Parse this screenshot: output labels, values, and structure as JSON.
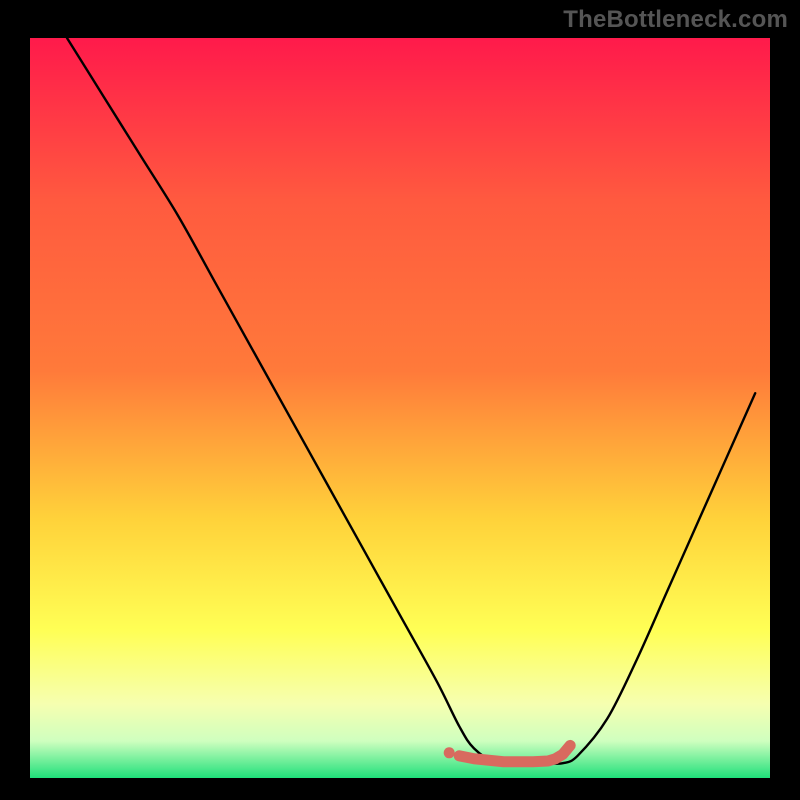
{
  "watermark": "TheBottleneck.com",
  "colors": {
    "bg": "#000000",
    "grad_top": "#ff1a4b",
    "grad_mid1": "#ff7a3a",
    "grad_mid2": "#ffd23a",
    "grad_mid3": "#ffff55",
    "grad_low1": "#f6ffb0",
    "grad_low2": "#cfffbf",
    "grad_bot": "#1fe07a",
    "curve": "#000000",
    "marker": "#d86a5f"
  },
  "chart_data": {
    "type": "line",
    "title": "",
    "xlabel": "",
    "ylabel": "",
    "xlim": [
      0,
      100
    ],
    "ylim": [
      0,
      100
    ],
    "series": [
      {
        "name": "bottleneck-curve",
        "x": [
          5,
          10,
          15,
          20,
          25,
          30,
          35,
          40,
          45,
          50,
          55,
          58,
          60,
          63,
          66,
          70,
          72,
          74,
          78,
          82,
          86,
          90,
          94,
          98
        ],
        "y": [
          100,
          92,
          84,
          76,
          67,
          58,
          49,
          40,
          31,
          22,
          13,
          7,
          4,
          2,
          2,
          2,
          2,
          3,
          8,
          16,
          25,
          34,
          43,
          52
        ]
      }
    ],
    "markers": {
      "name": "optimal-range",
      "x": [
        58,
        60,
        62,
        64,
        66,
        68,
        70,
        71,
        72,
        73
      ],
      "y": [
        3.0,
        2.6,
        2.4,
        2.2,
        2.2,
        2.2,
        2.3,
        2.6,
        3.2,
        4.4
      ]
    }
  }
}
